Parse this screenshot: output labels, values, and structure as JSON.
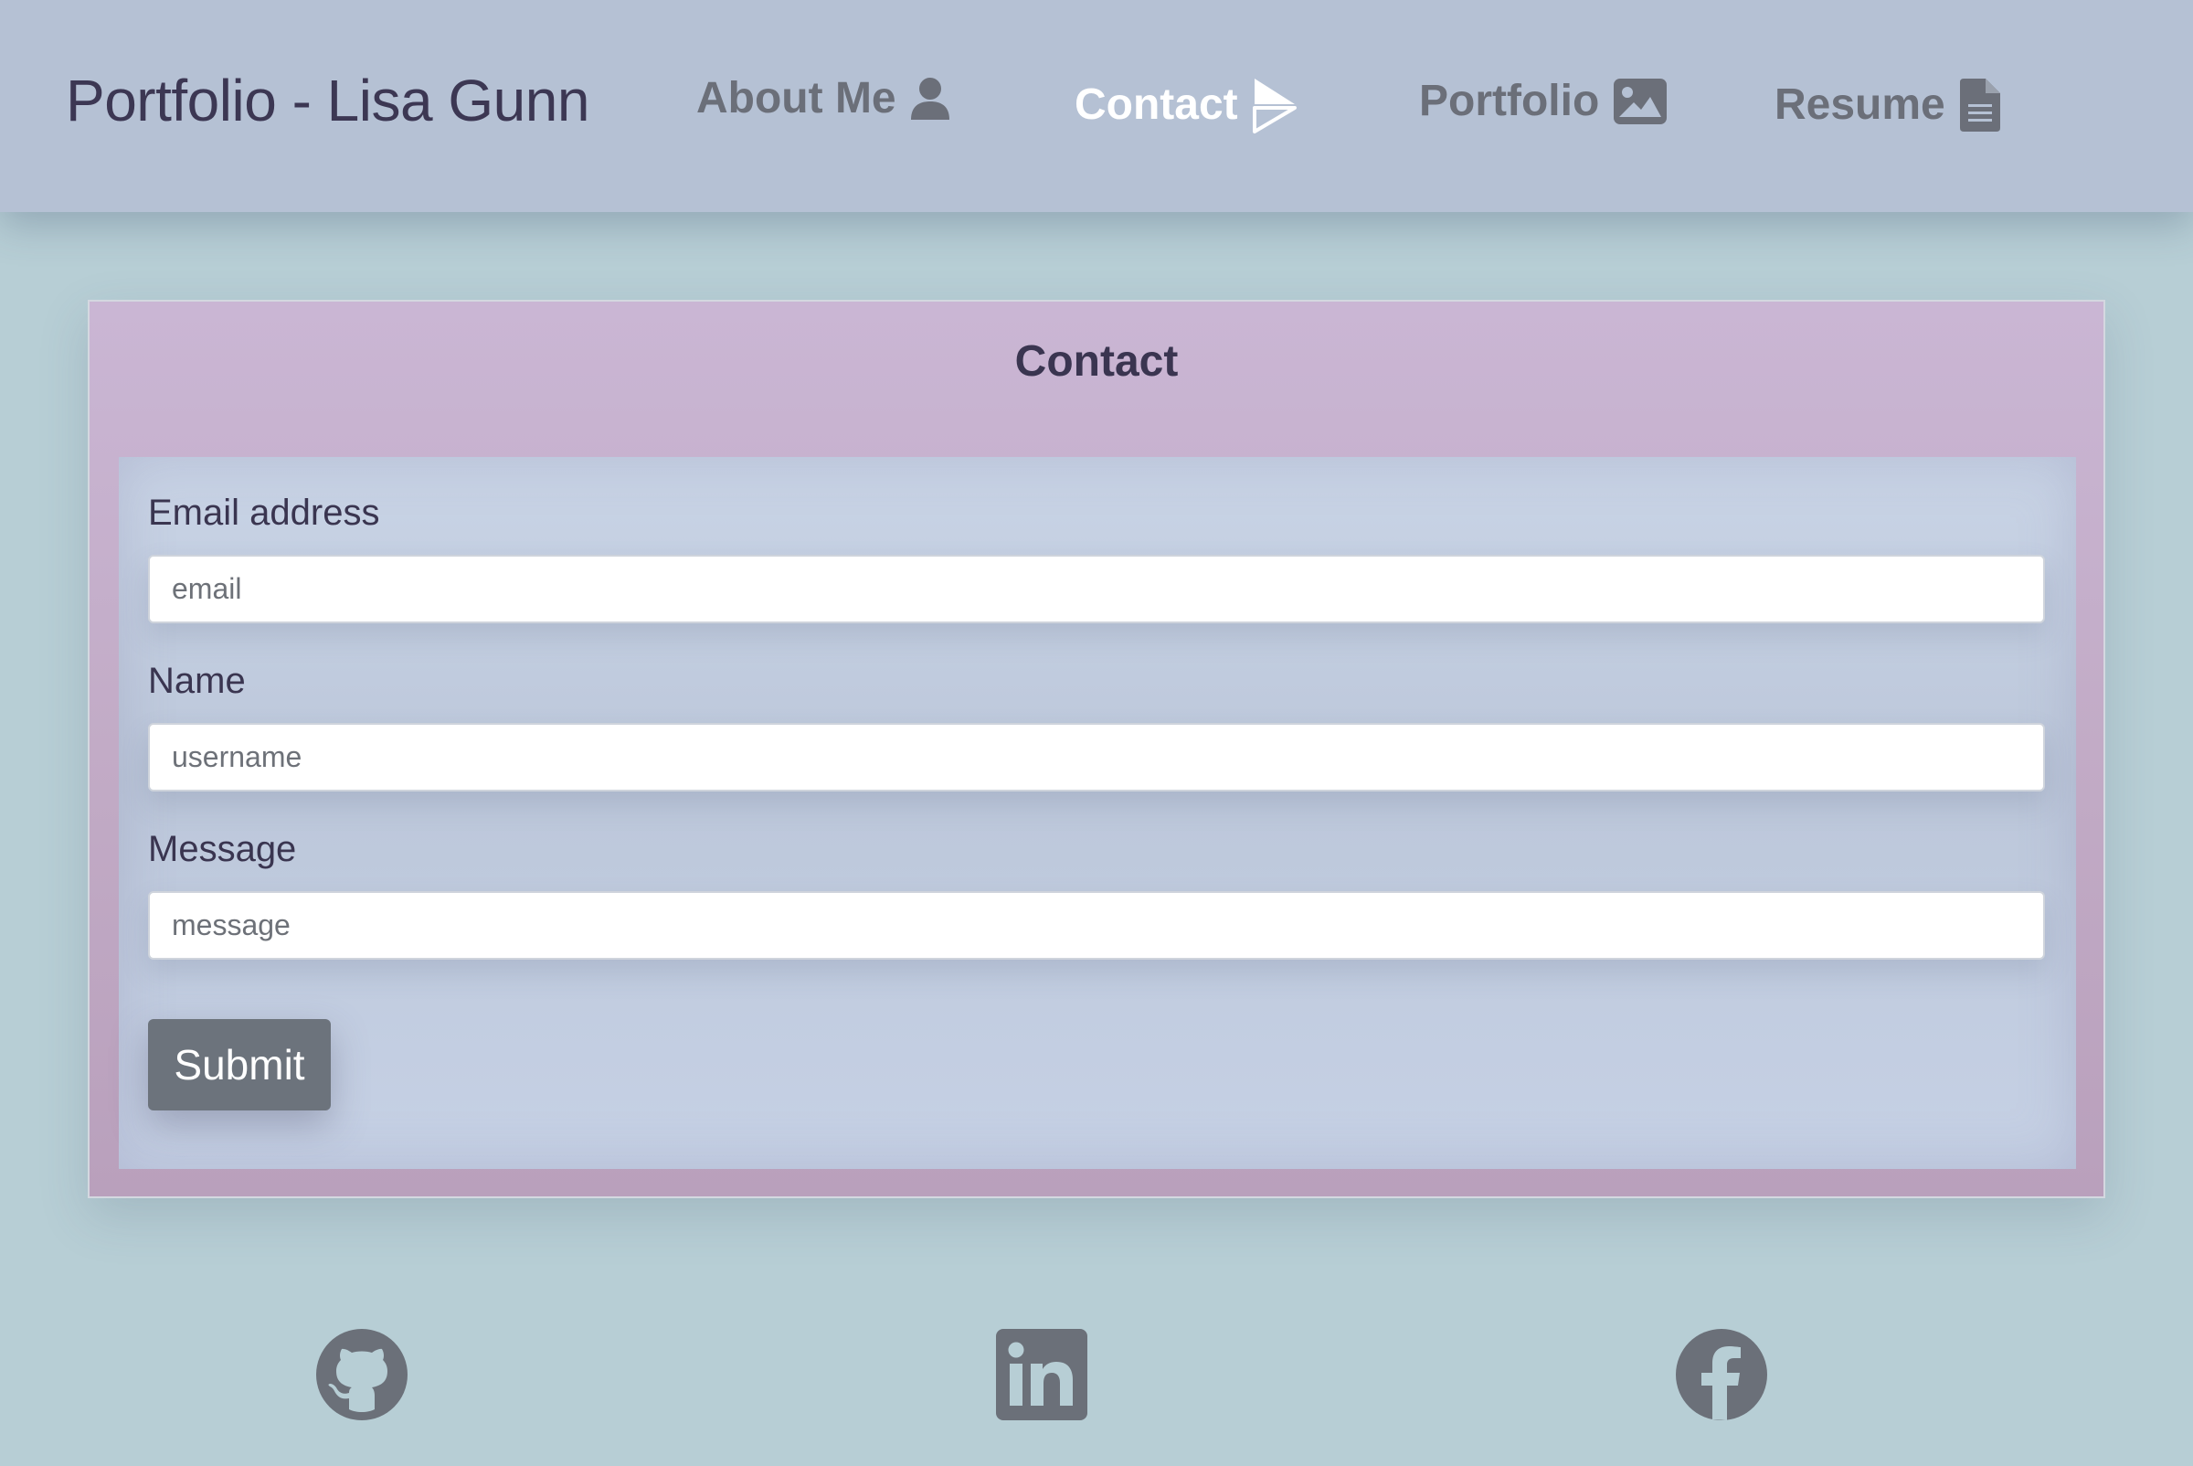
{
  "navbar": {
    "brand": "Portfolio - Lisa Gunn",
    "links": [
      {
        "label": "About Me",
        "icon": "user-icon",
        "active": false
      },
      {
        "label": "Contact",
        "icon": "paper-plane-icon",
        "active": true
      },
      {
        "label": "Portfolio",
        "icon": "image-icon",
        "active": false
      },
      {
        "label": "Resume",
        "icon": "file-icon",
        "active": false
      }
    ]
  },
  "contact": {
    "title": "Contact",
    "email_label": "Email address",
    "email_placeholder": "email",
    "name_label": "Name",
    "name_placeholder": "username",
    "message_label": "Message",
    "message_placeholder": "message",
    "submit_label": "Submit"
  },
  "footer": {
    "social": [
      {
        "icon": "github-icon"
      },
      {
        "icon": "linkedin-icon"
      },
      {
        "icon": "facebook-icon"
      }
    ]
  },
  "colors": {
    "page_background": "#b7ced5",
    "navbar_background": "#b5c1d4",
    "card_background": "#c7b3cd",
    "form_background": "#c9d4e6",
    "nav_text": "#6b6f79",
    "nav_active_text": "#ffffff",
    "heading_text": "#3a3550",
    "button_background": "#6c737c",
    "icon_color": "#6b7079"
  }
}
